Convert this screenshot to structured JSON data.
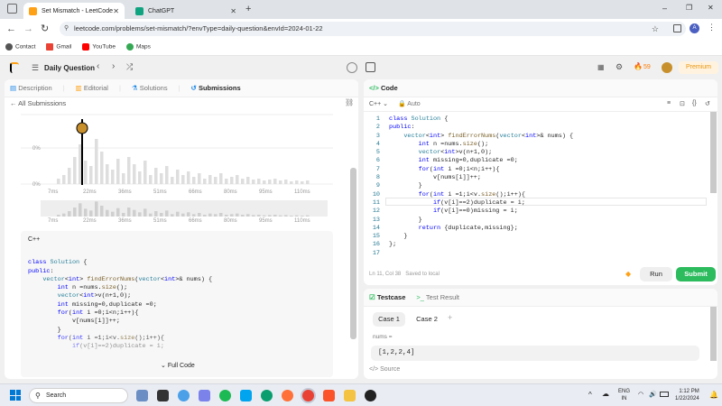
{
  "browser": {
    "tabs": [
      {
        "title": "Set Mismatch - LeetCode"
      },
      {
        "title": "ChatGPT"
      }
    ],
    "url": "leetcode.com/problems/set-mismatch/?envType=daily-question&envId=2024-01-22",
    "bookmarks": [
      "Contact",
      "Gmail",
      "YouTube",
      "Maps"
    ]
  },
  "header": {
    "daily": "Daily Question",
    "streak": "59",
    "premium": "Premium"
  },
  "left": {
    "tabs": [
      "Description",
      "Editorial",
      "Solutions",
      "Submissions"
    ],
    "all_submissions": "All Submissions",
    "lang": "C++",
    "full_code": "Full Code",
    "chart": {
      "y_ticks": [
        "0%",
        "0%"
      ],
      "x_ticks": [
        "7ms",
        "22ms",
        "36ms",
        "51ms",
        "66ms",
        "80ms",
        "95ms",
        "110ms"
      ],
      "x_ticks_mini": [
        "7ms",
        "22ms",
        "36ms",
        "51ms",
        "66ms",
        "80ms",
        "95ms",
        "110ms"
      ]
    },
    "code": [
      "",
      "class Solution {",
      "public:",
      "    vector<int> findErrorNums(vector<int>& nums) {",
      "        int n =nums.size();",
      "        vector<int>v(n+1,0);",
      "        int missing=0,duplicate =0;",
      "        for(int i =0;i<n;i++){",
      "            v[nums[i]]++;",
      "        }",
      "        for(int i =1;i<v.size();i++){",
      "            if(v[i]==2)duplicate = i;"
    ]
  },
  "editor": {
    "title": "Code",
    "lang": "C++",
    "auto": "Auto",
    "lines": [
      "class Solution {",
      "public:",
      "    vector<int> findErrorNums(vector<int>& nums) {",
      "        int n =nums.size();",
      "        vector<int>v(n+1,0);",
      "        int missing=0,duplicate =0;",
      "        for(int i =0;i<n;i++){",
      "            v[nums[i]]++;",
      "        }",
      "        for(int i =1;i<v.size();i++){",
      "            if(v[i]==2)duplicate = i;",
      "            if(v[i]==0)missing = i;",
      "        }",
      "        return {duplicate,missing};",
      "    }",
      "};",
      ""
    ],
    "status": "Ln 11, Col 38",
    "saved": "Saved to local",
    "run": "Run",
    "submit": "Submit"
  },
  "testcase": {
    "tab1": "Testcase",
    "tab2": "Test Result",
    "cases": [
      "Case 1",
      "Case 2"
    ],
    "label": "nums =",
    "value": "[1,2,2,4]",
    "source": "Source"
  },
  "taskbar": {
    "search": "Search",
    "lang1": "ENG",
    "lang2": "IN",
    "time": "1:12 PM",
    "date": "1/22/2024"
  }
}
